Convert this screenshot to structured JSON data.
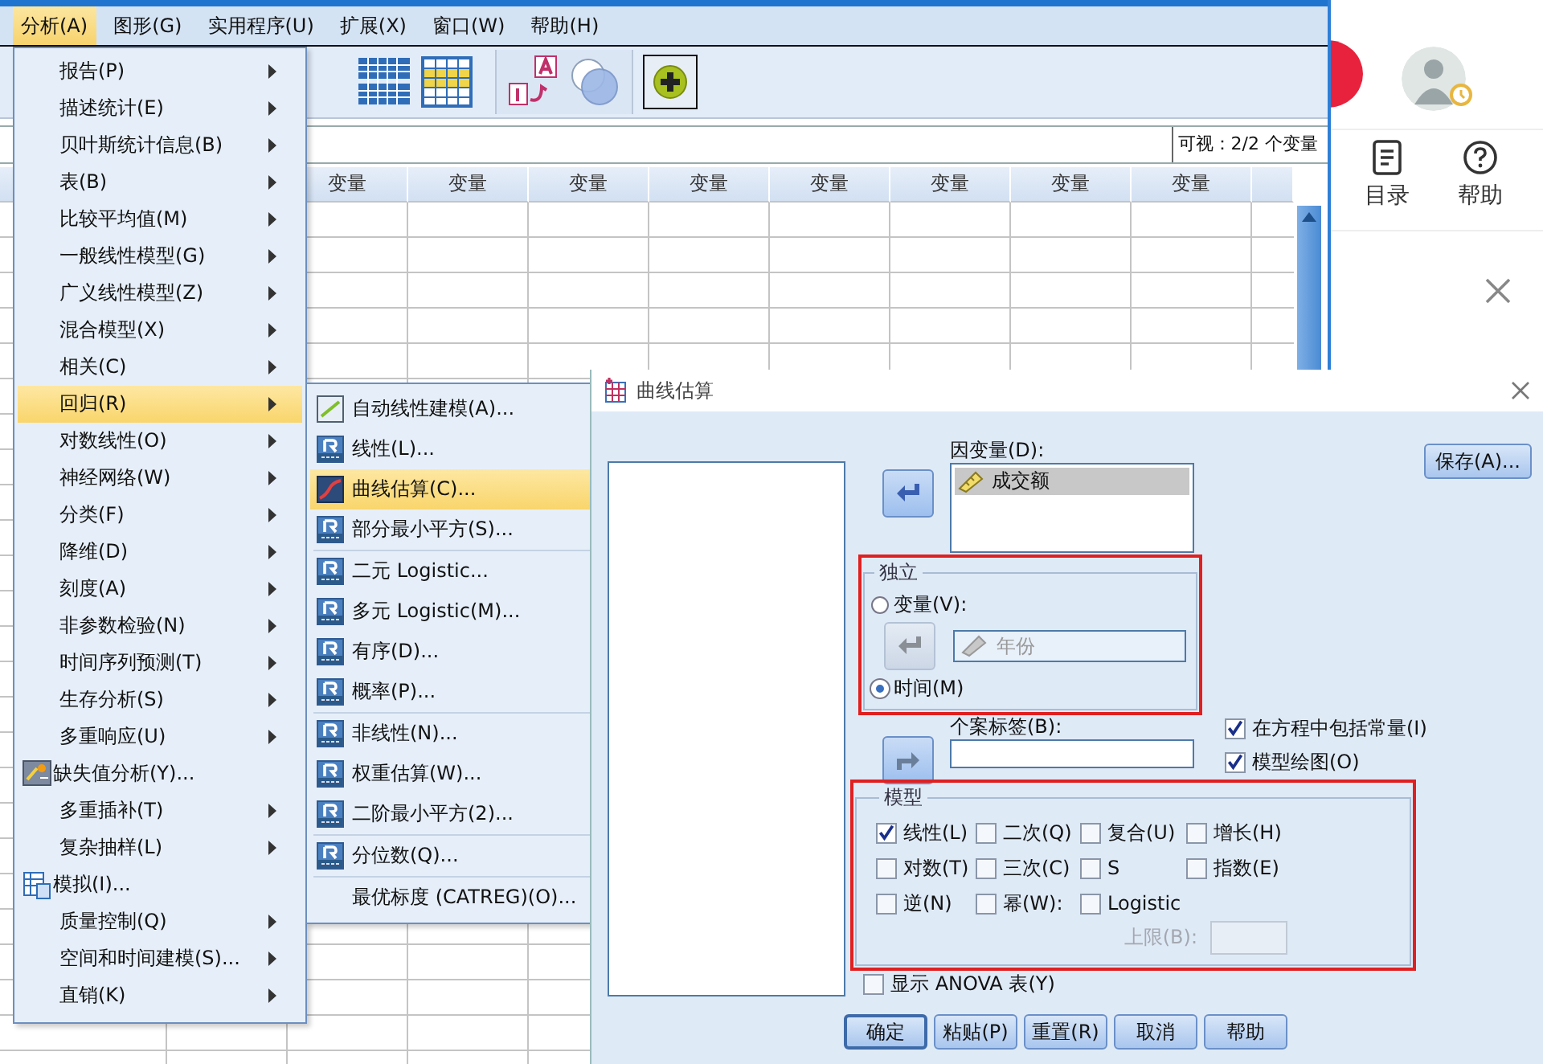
{
  "app_window": {
    "menu_bar": [
      {
        "label": "分析(A)",
        "selected": true
      },
      {
        "label": "图形(G)",
        "selected": false
      },
      {
        "label": "实用程序(U)",
        "selected": false
      },
      {
        "label": "扩展(X)",
        "selected": false
      },
      {
        "label": "窗口(W)",
        "selected": false
      },
      {
        "label": "帮助(H)",
        "selected": false
      }
    ],
    "status_text": "可视：2/2 个变量",
    "grid_columns": [
      "变量",
      "变量",
      "变量",
      "变量",
      "变量",
      "变量",
      "变量",
      "变量"
    ]
  },
  "analyze_menu": {
    "items": [
      {
        "label": "报告(P)",
        "kind": "submenu",
        "selected": false
      },
      {
        "label": "描述统计(E)",
        "kind": "submenu",
        "selected": false
      },
      {
        "label": "贝叶斯统计信息(B)",
        "kind": "submenu",
        "selected": false
      },
      {
        "label": "表(B)",
        "kind": "submenu",
        "selected": false
      },
      {
        "label": "比较平均值(M)",
        "kind": "submenu",
        "selected": false
      },
      {
        "label": "一般线性模型(G)",
        "kind": "submenu",
        "selected": false
      },
      {
        "label": "广义线性模型(Z)",
        "kind": "submenu",
        "selected": false
      },
      {
        "label": "混合模型(X)",
        "kind": "submenu",
        "selected": false
      },
      {
        "label": "相关(C)",
        "kind": "submenu",
        "selected": false
      },
      {
        "label": "回归(R)",
        "kind": "submenu",
        "selected": true
      },
      {
        "label": "对数线性(O)",
        "kind": "submenu",
        "selected": false
      },
      {
        "label": "神经网络(W)",
        "kind": "submenu",
        "selected": false
      },
      {
        "label": "分类(F)",
        "kind": "submenu",
        "selected": false
      },
      {
        "label": "降维(D)",
        "kind": "submenu",
        "selected": false
      },
      {
        "label": "刻度(A)",
        "kind": "submenu",
        "selected": false
      },
      {
        "label": "非参数检验(N)",
        "kind": "submenu",
        "selected": false
      },
      {
        "label": "时间序列预测(T)",
        "kind": "submenu",
        "selected": false
      },
      {
        "label": "生存分析(S)",
        "kind": "submenu",
        "selected": false
      },
      {
        "label": "多重响应(U)",
        "kind": "submenu",
        "selected": false
      },
      {
        "label": "缺失值分析(Y)...",
        "kind": "wizard",
        "selected": false
      },
      {
        "label": "多重插补(T)",
        "kind": "submenu",
        "selected": false
      },
      {
        "label": "复杂抽样(L)",
        "kind": "submenu",
        "selected": false
      },
      {
        "label": "模拟(I)...",
        "kind": "simulation",
        "selected": false
      },
      {
        "label": "质量控制(Q)",
        "kind": "submenu",
        "selected": false
      },
      {
        "label": "空间和时间建模(S)...",
        "kind": "submenu",
        "selected": false
      },
      {
        "label": "直销(K)",
        "kind": "submenu",
        "selected": false
      }
    ]
  },
  "regression_menu": {
    "groups": [
      [
        {
          "label": "自动线性建模(A)...",
          "kind": "trend",
          "selected": false
        },
        {
          "label": "线性(L)...",
          "kind": "regression",
          "selected": false
        },
        {
          "label": "曲线估算(C)...",
          "kind": "curve",
          "selected": true
        },
        {
          "label": "部分最小平方(S)...",
          "kind": "regression",
          "selected": false
        }
      ],
      [
        {
          "label": "二元 Logistic...",
          "kind": "regression",
          "selected": false
        },
        {
          "label": "多元 Logistic(M)...",
          "kind": "regression",
          "selected": false
        },
        {
          "label": "有序(D)...",
          "kind": "regression",
          "selected": false
        },
        {
          "label": "概率(P)...",
          "kind": "regression",
          "selected": false
        }
      ],
      [
        {
          "label": "非线性(N)...",
          "kind": "regression",
          "selected": false
        },
        {
          "label": "权重估算(W)...",
          "kind": "regression",
          "selected": false
        },
        {
          "label": "二阶最小平方(2)...",
          "kind": "regression",
          "selected": false
        }
      ],
      [
        {
          "label": "分位数(Q)...",
          "kind": "regression",
          "selected": false
        }
      ],
      [
        {
          "label": "最优标度 (CATREG)(O)...",
          "kind": "plain",
          "selected": false
        }
      ]
    ]
  },
  "dialog": {
    "title": "曲线估算",
    "dependent": {
      "label": "因变量(D):",
      "items": [
        {
          "label": "成交额",
          "selected": true
        }
      ]
    },
    "save_button": "保存(A)...",
    "independent": {
      "legend": "独立",
      "highlighted": true,
      "options": [
        {
          "label": "变量(V):",
          "selected": false
        },
        {
          "label": "时间(M)",
          "selected": true
        }
      ],
      "variable_value": "年份"
    },
    "case_labels": {
      "label": "个案标签(B):"
    },
    "options": [
      {
        "label": "在方程中包括常量(I)",
        "checked": true
      },
      {
        "label": "模型绘图(O)",
        "checked": true
      }
    ],
    "models": {
      "legend": "模型",
      "highlighted": true,
      "items": [
        {
          "label": "线性(L)",
          "checked": true
        },
        {
          "label": "二次(Q)",
          "checked": false
        },
        {
          "label": "复合(U)",
          "checked": false
        },
        {
          "label": "增长(H)",
          "checked": false
        },
        {
          "label": "对数(T)",
          "checked": false
        },
        {
          "label": "三次(C)",
          "checked": false
        },
        {
          "label": "S",
          "checked": false
        },
        {
          "label": "指数(E)",
          "checked": false
        },
        {
          "label": "逆(N)",
          "checked": false
        },
        {
          "label": "幂(W):",
          "checked": false
        },
        {
          "label": "Logistic",
          "checked": false
        }
      ],
      "upper_bound": {
        "label": "上限(B):",
        "disabled": true
      }
    },
    "anova": {
      "label": "显示 ANOVA 表(Y)",
      "checked": false
    },
    "buttons": [
      {
        "label": "确定",
        "default": true
      },
      {
        "label": "粘贴(P)",
        "default": false
      },
      {
        "label": "重置(R)",
        "default": false
      },
      {
        "label": "取消",
        "default": false
      },
      {
        "label": "帮助",
        "default": false
      }
    ]
  },
  "side_panel": {
    "tools": [
      {
        "label": "目录"
      },
      {
        "label": "帮助"
      }
    ]
  }
}
